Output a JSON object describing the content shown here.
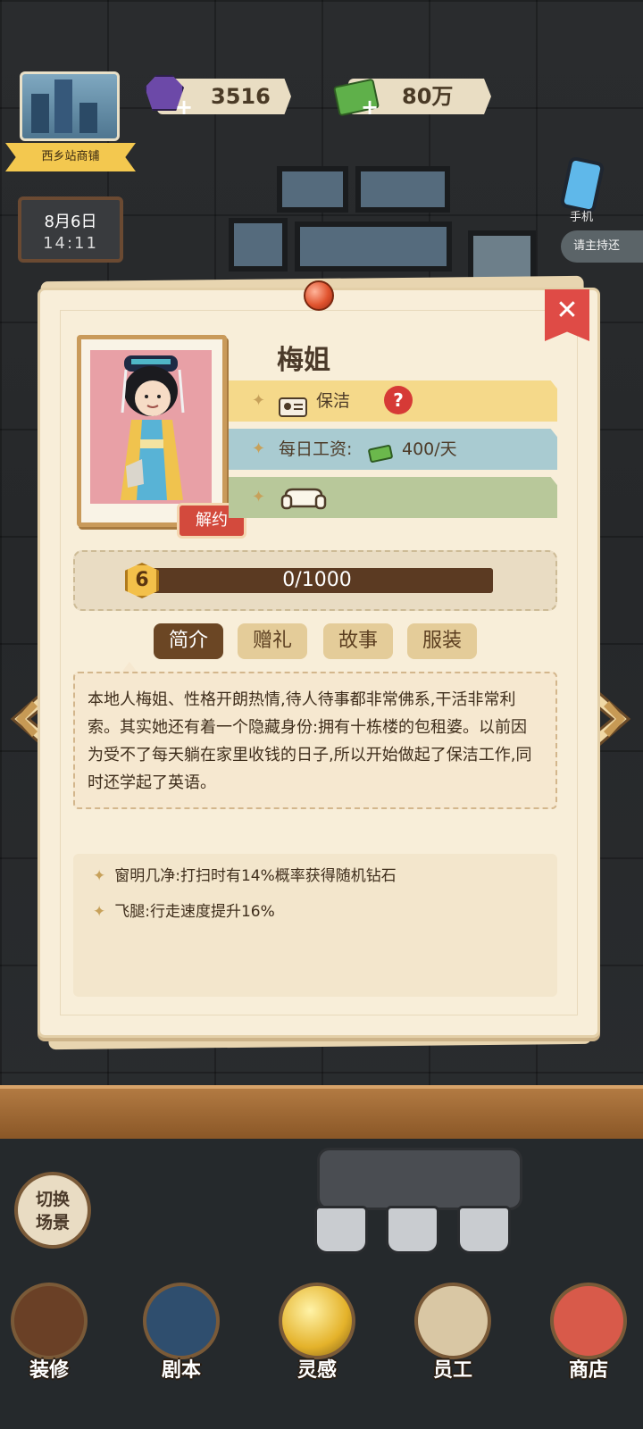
{
  "hud": {
    "location": "西乡站商铺",
    "gems": "3516",
    "cash": "80万",
    "date": "8月6日",
    "time": "14:11",
    "phone_label": "手机",
    "right_bubble": "请主持还"
  },
  "character": {
    "name": "梅姐",
    "job": "保洁",
    "wage_label": "每日工资:",
    "wage_value": "400/天",
    "dismiss": "解约",
    "level": "6",
    "exp_text": "0/1000",
    "exp_fraction": 0.0
  },
  "tabs": [
    {
      "label": "简介",
      "active": true
    },
    {
      "label": "赠礼",
      "active": false
    },
    {
      "label": "故事",
      "active": false
    },
    {
      "label": "服装",
      "active": false
    }
  ],
  "intro": "本地人梅姐、性格开朗热情,待人待事都非常佛系,干活非常利索。其实她还有着一个隐藏身份:拥有十栋楼的包租婆。以前因为受不了每天躺在家里收钱的日子,所以开始做起了保洁工作,同时还学起了英语。",
  "traits": [
    "窗明几净:打扫时有14%概率获得随机钻石",
    "飞腿:行走速度提升16%"
  ],
  "switch_scene": [
    "切换",
    "场景"
  ],
  "nav": [
    {
      "label": "装修",
      "icon": "house-icon"
    },
    {
      "label": "剧本",
      "icon": "book-icon"
    },
    {
      "label": "灵感",
      "icon": "bulb-icon"
    },
    {
      "label": "员工",
      "icon": "staff-card-icon"
    },
    {
      "label": "商店",
      "icon": "shop-icon"
    }
  ],
  "colors": {
    "card_bg": "#f8eed9",
    "ribbon_yellow": "#f5d98a",
    "ribbon_blue": "#a9cbd1",
    "ribbon_green": "#b8c89a",
    "active_tab": "#6b4624",
    "close_red": "#df4b46"
  }
}
